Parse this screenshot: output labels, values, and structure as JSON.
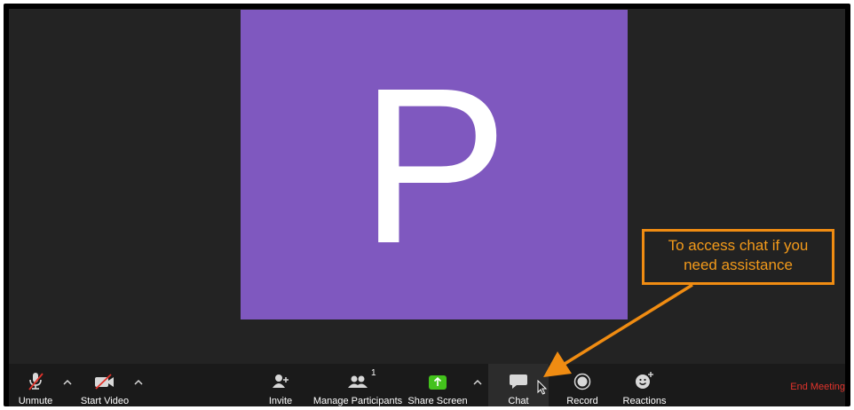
{
  "participant": {
    "initial": "P",
    "tile_color": "#7f58bf"
  },
  "toolbar": {
    "unmute_label": "Unmute",
    "start_video_label": "Start Video",
    "invite_label": "Invite",
    "manage_participants_label": "Manage Participants",
    "participants_count": "1",
    "share_screen_label": "Share Screen",
    "chat_label": "Chat",
    "record_label": "Record",
    "reactions_label": "Reactions",
    "end_meeting_label": "End Meeting"
  },
  "annotation": {
    "callout_line1": "To access chat if you",
    "callout_line2": "need assistance",
    "color": "#f08c12"
  },
  "icons": {
    "unmute": "microphone-muted-icon",
    "start_video": "video-camera-off-icon",
    "invite": "add-person-icon",
    "participants": "participants-icon",
    "share_screen": "share-screen-icon",
    "chat": "chat-bubble-icon",
    "record": "record-icon",
    "reactions": "smiley-add-icon"
  },
  "colors": {
    "end_meeting": "#e2332b",
    "share_screen_green": "#43c21c",
    "toolbar_bg": "#1a1a1a"
  }
}
